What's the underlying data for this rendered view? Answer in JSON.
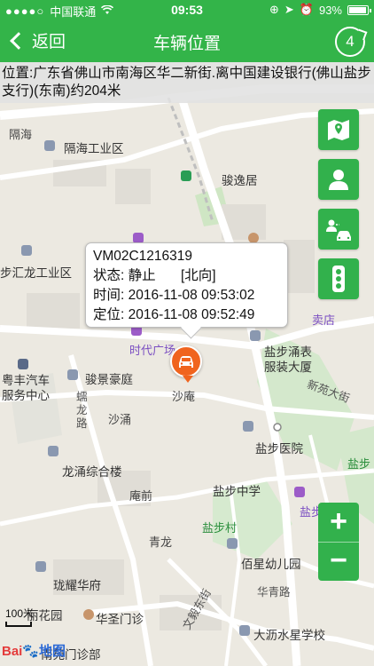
{
  "status_bar": {
    "carrier": "中国联通",
    "time": "09:53",
    "battery": "93%"
  },
  "nav": {
    "back_label": "返回",
    "title": "车辆位置",
    "refresh_count": "4"
  },
  "address": "位置:广东省佛山市南海区华二新街.离中国建设银行(佛山盐步支行)(东南)约204米",
  "popup": {
    "plate": "VM02C1216319",
    "status_label": "状态:",
    "status_value": "静止",
    "direction": "[北向]",
    "time_label": "时间:",
    "time_value": "2016-11-08 09:53:02",
    "locate_label": "定位:",
    "locate_value": "2016-11-08 09:52:49"
  },
  "map_labels": {
    "l1": "隔海",
    "l2": "隔海工业区",
    "l3": "骏逸居",
    "l4": "步汇龙工业区",
    "l5": "时代广场",
    "l6": "骏景豪庭",
    "l7": "沙庵",
    "l8": "盐步涌表服装大厦",
    "l9": "新苑大街",
    "l10": "粤丰汽车服务中心",
    "l11": "蠕龙路",
    "l12": "沙涌",
    "l13": "盐步医院",
    "l14": "盐步",
    "l15": "龙涌综合楼",
    "l16": "庵前",
    "l17": "盐步中学",
    "l18": "盐步市场",
    "l19": "青龙",
    "l20": "盐步村",
    "l21": "佰星幼儿园",
    "l22": "珑耀华府",
    "l23": "华青路",
    "l24": "丽花园",
    "l25": "华圣门诊",
    "l26": "文毅东街",
    "l27": "大沥水星学校",
    "l28": "南苑门诊部",
    "l29": "卖店"
  },
  "scale_label": "100米",
  "logo": {
    "bai": "Bai",
    "du_map": "地图"
  },
  "icons": {
    "map": "map-icon",
    "person": "person-icon",
    "person_car": "person-car-icon",
    "traffic": "traffic-light-icon",
    "car": "car-icon"
  },
  "zoom": {
    "in": "+",
    "out": "−"
  },
  "colors": {
    "brand_green": "#33b449",
    "marker_orange": "#f0641e"
  }
}
